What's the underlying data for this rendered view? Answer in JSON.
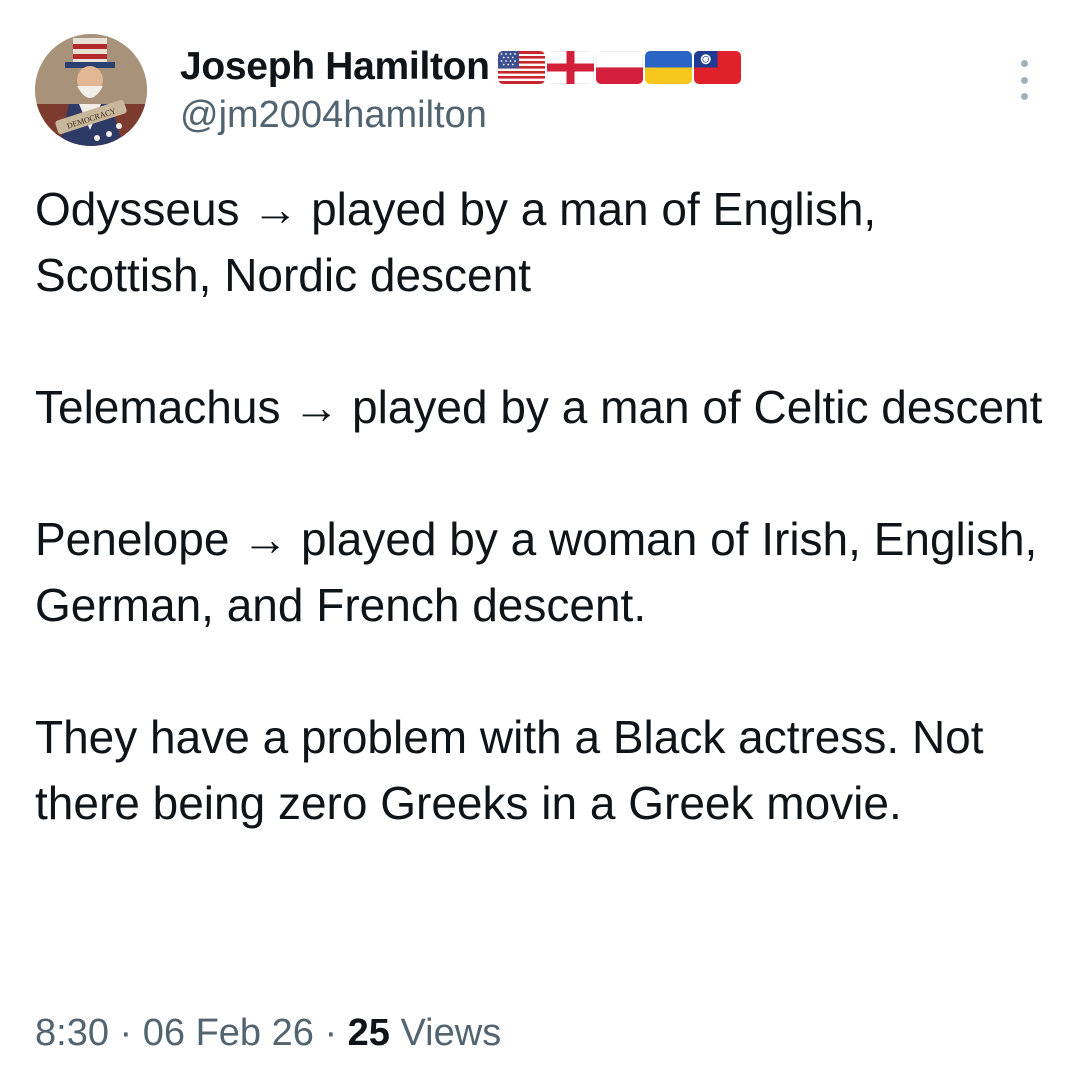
{
  "author": {
    "display_name": "Joseph Hamilton",
    "handle": "@jm2004hamilton",
    "flags": [
      "us-flag-icon",
      "england-flag-icon",
      "poland-flag-icon",
      "ukraine-flag-icon",
      "taiwan-flag-icon"
    ],
    "avatar_text": "DEMOCRACY"
  },
  "tweet": {
    "paragraphs": [
      "Odysseus → played by a man of English, Scottish, Nordic descent",
      "Telemachus → played by a man of Celtic descent",
      "Penelope → played by a woman of Irish, English, German, and French descent.",
      "They have a problem with a Black actress. Not there being zero Greeks in a Greek movie."
    ]
  },
  "meta": {
    "time": "8:30",
    "separator": " · ",
    "date": "06 Feb 26",
    "views_count": "25",
    "views_label": " Views"
  },
  "colors": {
    "text_primary": "#0f1419",
    "text_secondary": "#536471"
  }
}
